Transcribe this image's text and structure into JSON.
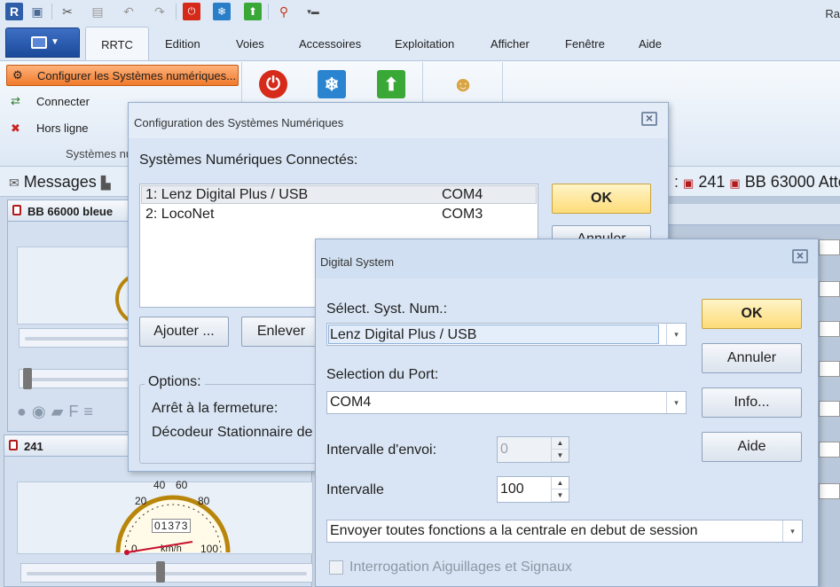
{
  "window": {
    "user_short": "Ra"
  },
  "tabs": [
    {
      "label": "RRTC"
    },
    {
      "label": "Edition"
    },
    {
      "label": "Voies"
    },
    {
      "label": "Accessoires"
    },
    {
      "label": "Exploitation"
    },
    {
      "label": "Afficher"
    },
    {
      "label": "Fenêtre"
    },
    {
      "label": "Aide"
    }
  ],
  "ribbon": {
    "configure_label": "Configurer les Systèmes numériques...",
    "connect_label": "Connecter",
    "offline_label": "Hors ligne",
    "group_label": "Systèmes nu"
  },
  "docstrip": {
    "messages_label": "Messages",
    "loco_tab_1": "241",
    "loco_tab_2": "BB 63000 Atte"
  },
  "locos": [
    {
      "name": "BB 66000  bleue"
    },
    {
      "name": "241",
      "speed": "01373",
      "unit": "km/h",
      "dial": [
        "20",
        "40",
        "60",
        "80",
        "100",
        "0"
      ]
    }
  ],
  "config_dialog": {
    "title": "Configuration des Systèmes Numériques",
    "heading": "Systèmes Numériques Connectés:",
    "systems": [
      {
        "name": "1: Lenz Digital Plus / USB",
        "port": "COM4"
      },
      {
        "name": "2: LocoNet",
        "port": "COM3"
      }
    ],
    "ok_label": "OK",
    "cancel_label": "Annuler",
    "add_label": "Ajouter ...",
    "remove_label": "Enlever",
    "options_label": "Options:",
    "option_1": "Arrêt à la fermeture:",
    "option_2": "Décodeur Stationnaire de"
  },
  "digital_dialog": {
    "title": "Digital System",
    "select_label": "Sélect. Syst. Num.:",
    "select_value": "Lenz Digital Plus / USB",
    "port_label": "Selection du Port:",
    "port_value": "COM4",
    "send_interval_label": "Intervalle d'envoi:",
    "send_interval_value": "0",
    "interval_label": "Intervalle",
    "interval_value": "100",
    "functions_value": "Envoyer toutes fonctions a la centrale en debut de session",
    "poll_label": "Interrogation Aiguillages et Signaux",
    "ok_label": "OK",
    "cancel_label": "Annuler",
    "info_label": "Info...",
    "help_label": "Aide"
  }
}
